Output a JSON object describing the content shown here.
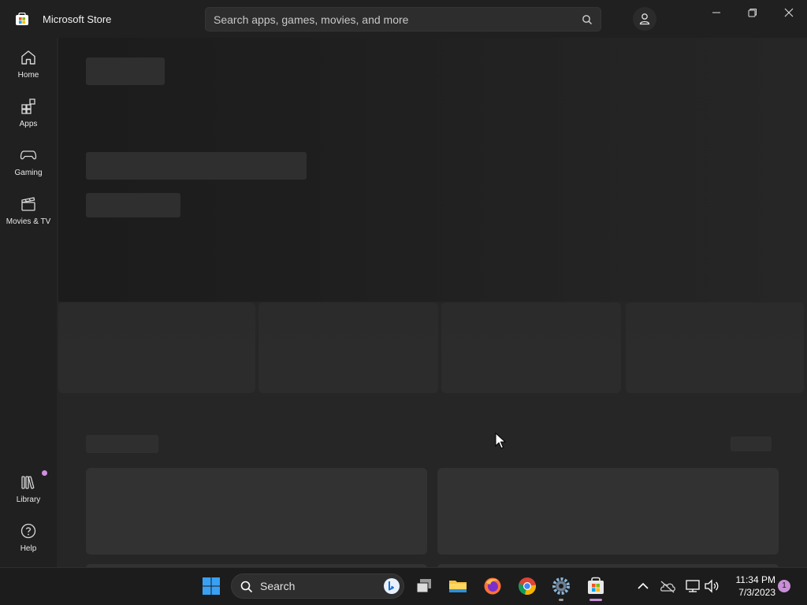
{
  "app": {
    "title": "Microsoft Store"
  },
  "search": {
    "placeholder": "Search apps, games, movies, and more",
    "icon": "search-icon"
  },
  "window_controls": [
    "minimize-icon",
    "restore-icon",
    "close-icon"
  ],
  "sidebar": {
    "items": [
      {
        "label": "Home",
        "icon": "home-icon"
      },
      {
        "label": "Apps",
        "icon": "apps-icon"
      },
      {
        "label": "Gaming",
        "icon": "gamepad-icon"
      },
      {
        "label": "Movies & TV",
        "icon": "clapperboard-icon"
      }
    ],
    "bottom_items": [
      {
        "label": "Library",
        "icon": "library-icon",
        "has_badge": true
      },
      {
        "label": "Help",
        "icon": "help-icon"
      }
    ]
  },
  "main": {
    "state": "loading-skeleton"
  },
  "taskbar": {
    "search_label": "Search",
    "time": "11:34 PM",
    "date": "7/3/2023",
    "notification_count": "1",
    "apps": [
      "windows-start-icon",
      "taskview-icon",
      "file-explorer-icon",
      "firefox-icon",
      "chrome-icon",
      "settings-icon",
      "microsoft-store-icon"
    ],
    "tray": [
      "chevron-up-icon",
      "onedrive-offline-icon",
      "network-icon",
      "volume-icon"
    ]
  },
  "colors": {
    "accent": "#c88fd8",
    "background": "#1f1f1f",
    "skeleton": "#2f2f2f"
  }
}
